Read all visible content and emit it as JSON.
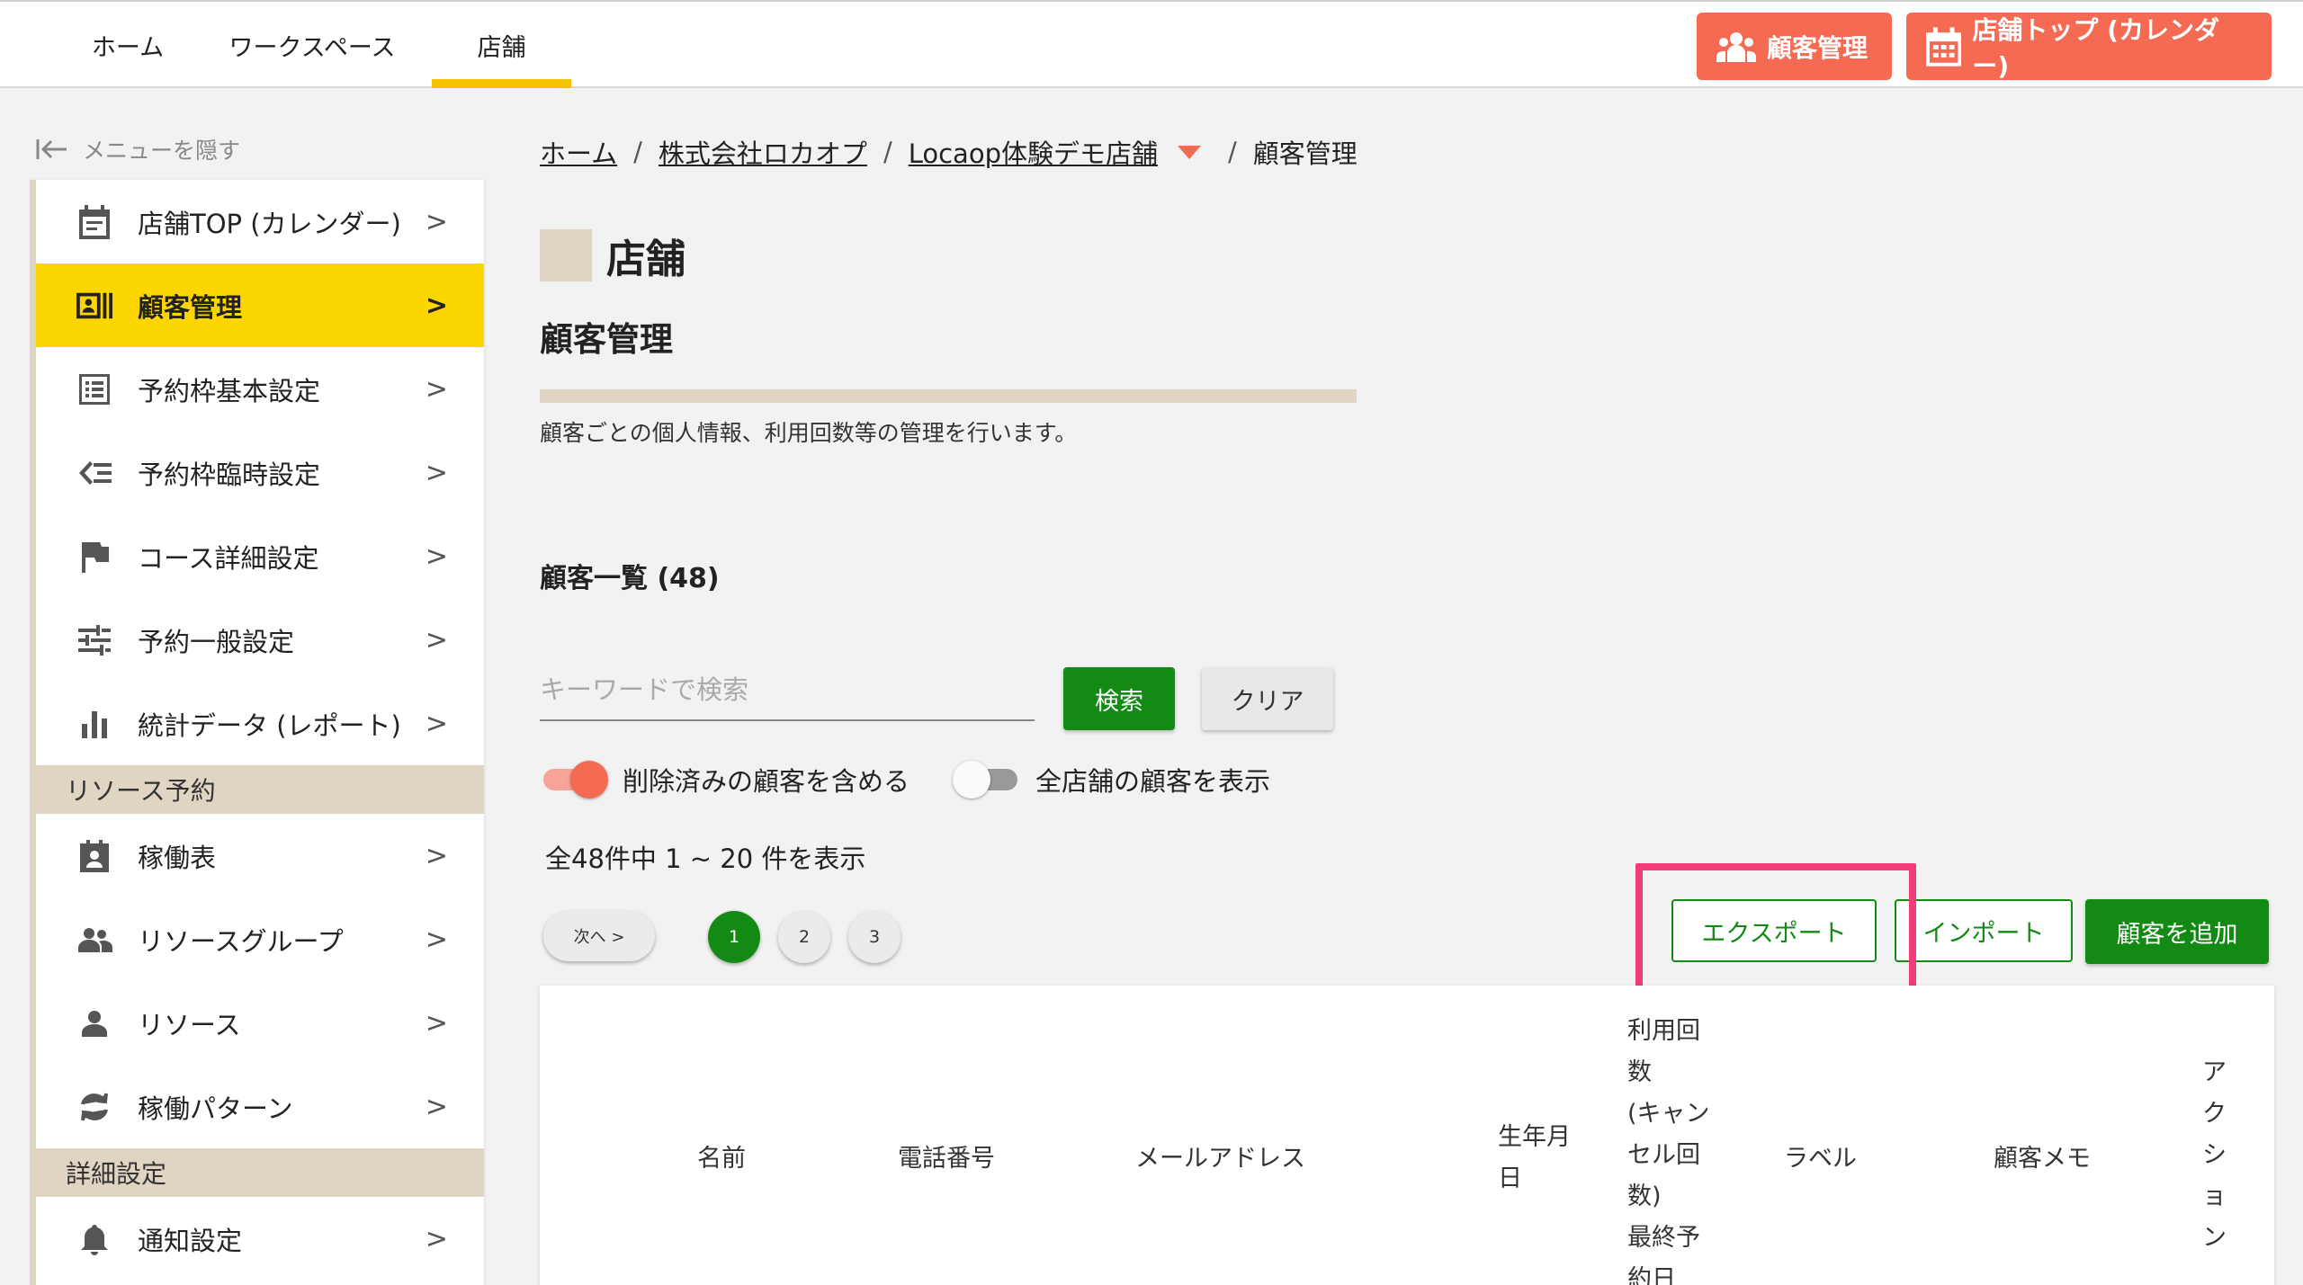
{
  "topnav": {
    "tabs": [
      "ホーム",
      "ワークスペース",
      "店舗"
    ],
    "active_tab": "店舗"
  },
  "header_buttons": {
    "customer_mgmt": "顧客管理",
    "store_top": "店舗トップ (カレンダー)"
  },
  "sidebar": {
    "hide_menu": "メニューを隠す",
    "items": [
      {
        "label": "店舗TOP (カレンダー)",
        "icon": "calendar-icon"
      },
      {
        "label": "顧客管理",
        "icon": "contact-card-icon",
        "active": true
      },
      {
        "label": "予約枠基本設定",
        "icon": "list-icon"
      },
      {
        "label": "予約枠臨時設定",
        "icon": "playlist-icon"
      },
      {
        "label": "コース詳細設定",
        "icon": "flag-icon"
      },
      {
        "label": "予約一般設定",
        "icon": "sliders-icon"
      },
      {
        "label": "統計データ (レポート)",
        "icon": "bar-chart-icon"
      }
    ],
    "section_resource": "リソース予約",
    "resource_items": [
      {
        "label": "稼働表",
        "icon": "assignment-icon"
      },
      {
        "label": "リソースグループ",
        "icon": "group-icon"
      },
      {
        "label": "リソース",
        "icon": "person-icon"
      },
      {
        "label": "稼働パターン",
        "icon": "sync-icon"
      }
    ],
    "section_detail": "詳細設定",
    "detail_items": [
      {
        "label": "通知設定",
        "icon": "bell-icon"
      }
    ],
    "chevron": ">"
  },
  "breadcrumb": {
    "home": "ホーム",
    "company": "株式会社ロカオプ",
    "store": "Locaop体験デモ店舗",
    "current": "顧客管理",
    "sep": "/"
  },
  "store_title": "店舗",
  "page_title": "顧客管理",
  "description": "顧客ごとの個人情報、利用回数等の管理を行います。",
  "list_title": "顧客一覧 (48)",
  "search": {
    "placeholder": "キーワードで検索",
    "value": "",
    "search_label": "検索",
    "clear_label": "クリア"
  },
  "toggles": {
    "include_deleted": {
      "label": "削除済みの顧客を含める",
      "on": true
    },
    "all_stores": {
      "label": "全店舗の顧客を表示",
      "on": false
    }
  },
  "count_text": "全48件中 1 ~ 20 件を表示",
  "pagination": {
    "next": "次へ >",
    "pages": [
      "1",
      "2",
      "3"
    ],
    "current": "1"
  },
  "actions": {
    "export": "エクスポート",
    "import": "インポート",
    "add": "顧客を追加"
  },
  "table": {
    "headers": {
      "name": "名前",
      "phone": "電話番号",
      "email": "メールアドレス",
      "birthday_l1": "生年月",
      "birthday_l2": "日",
      "usage_lines": [
        "利用回",
        "数",
        "(キャン",
        "セル回",
        "数)",
        "最終予",
        "約日"
      ],
      "label": "ラベル",
      "memo": "顧客メモ",
      "action_lines": [
        "ア",
        "ク",
        "シ",
        "ョ",
        "ン"
      ]
    }
  },
  "colors": {
    "accent_coral": "#f46a53",
    "active_yellow": "#fdd600",
    "primary_green": "#138a13",
    "beige": "#e0d4c3",
    "highlight_pink": "#f03c78"
  }
}
